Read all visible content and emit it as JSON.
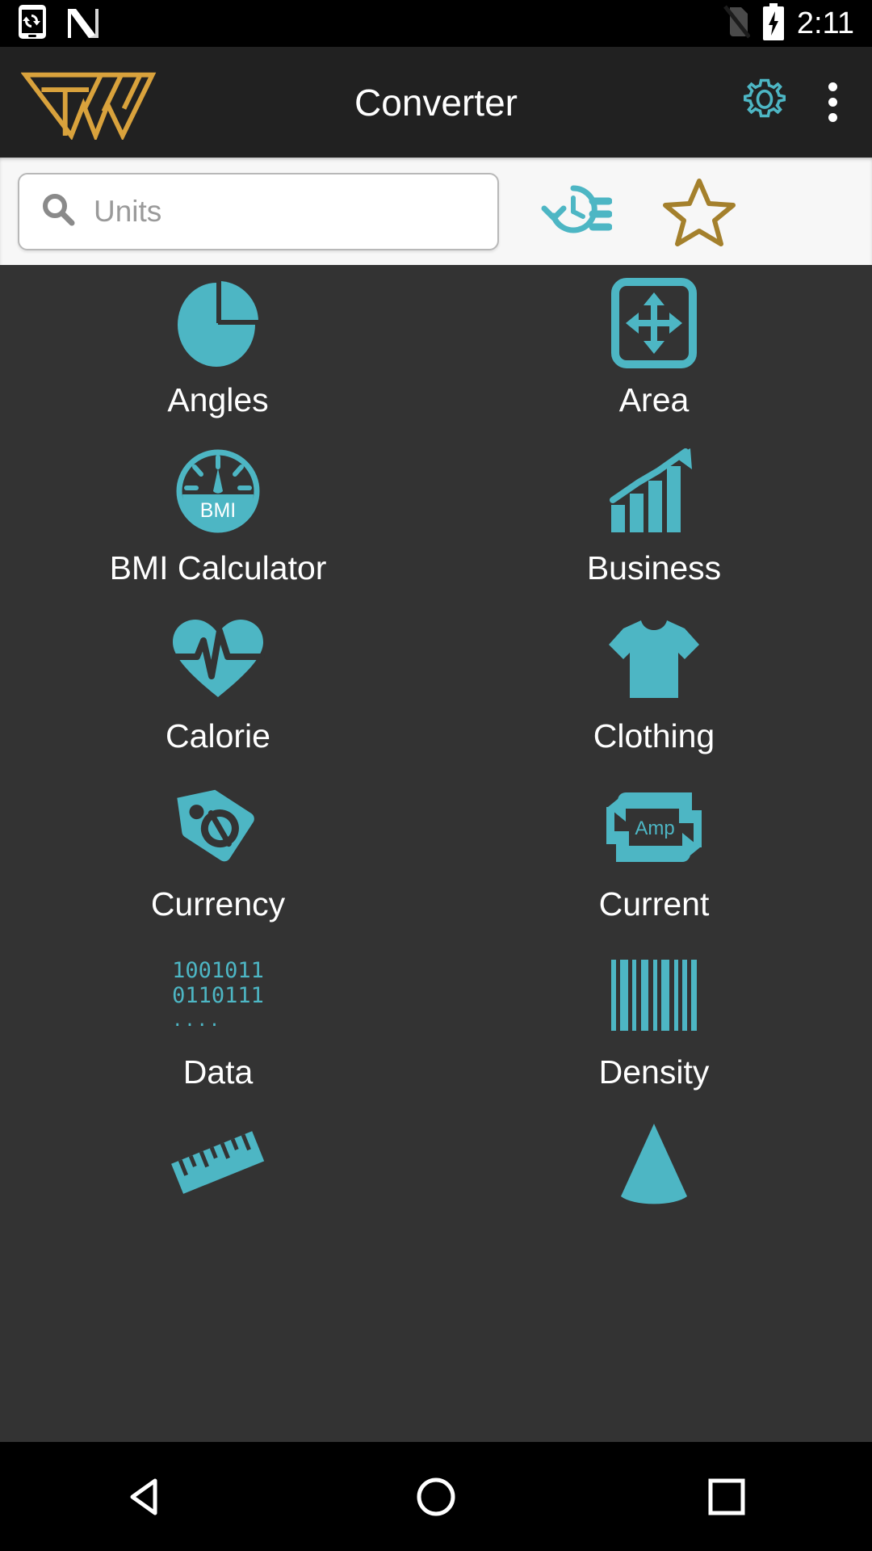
{
  "statusbar": {
    "time": "2:11",
    "icons": [
      "phone-sync-icon",
      "android-nougat-icon",
      "no-sim-icon",
      "battery-charging-icon"
    ]
  },
  "appbar": {
    "title": "Converter",
    "logo_name": "tw-logo",
    "settings_label": "Settings",
    "overflow_label": "More options",
    "accent_gold": "#d9a23c",
    "accent_teal": "#4db6c4"
  },
  "search": {
    "placeholder": "Units",
    "value": "",
    "search_icon": "search-icon",
    "history_icon": "history-list-icon",
    "favorites_icon": "star-outline-icon"
  },
  "grid": {
    "items": [
      {
        "label": "Angles",
        "icon": "pie-chart-icon"
      },
      {
        "label": "Area",
        "icon": "area-arrows-icon"
      },
      {
        "label": "BMI Calculator",
        "icon": "bmi-gauge-icon",
        "icon_text": "BMI"
      },
      {
        "label": "Business",
        "icon": "bar-chart-growth-icon"
      },
      {
        "label": "Calorie",
        "icon": "heart-pulse-icon"
      },
      {
        "label": "Clothing",
        "icon": "t-shirt-icon"
      },
      {
        "label": "Currency",
        "icon": "price-tag-dollar-icon"
      },
      {
        "label": "Current",
        "icon": "amp-exchange-icon",
        "icon_text": "Amp"
      },
      {
        "label": "Data",
        "icon": "binary-digits-icon",
        "binary_lines": [
          "1001011",
          "0110111",
          "...."
        ]
      },
      {
        "label": "Density",
        "icon": "barcode-icon"
      },
      {
        "label": "",
        "icon": "ruler-icon"
      },
      {
        "label": "",
        "icon": "cone-icon"
      }
    ]
  },
  "navbar": {
    "back_label": "Back",
    "home_label": "Home",
    "recents_label": "Recent apps"
  }
}
